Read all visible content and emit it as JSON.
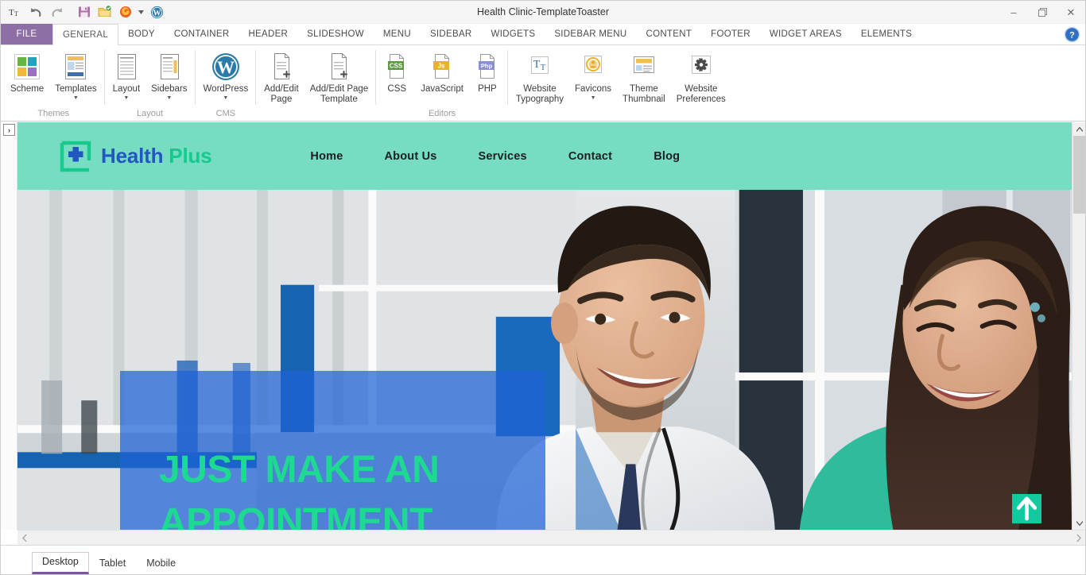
{
  "window": {
    "title": "Health Clinic-TemplateToaster",
    "minimize_label": "–",
    "restore_label": "❐",
    "close_label": "✕"
  },
  "quick_access": [
    {
      "name": "text-tool-icon",
      "tooltip": "Text"
    },
    {
      "name": "undo-icon",
      "tooltip": "Undo"
    },
    {
      "name": "redo-icon",
      "tooltip": "Redo"
    },
    {
      "name": "save-icon",
      "tooltip": "Save"
    },
    {
      "name": "export-icon",
      "tooltip": "Export"
    },
    {
      "name": "firefox-preview-icon",
      "tooltip": "Preview in Firefox"
    },
    {
      "name": "preview-dropdown-caret-icon",
      "tooltip": "More browsers"
    },
    {
      "name": "wordpress-icon",
      "tooltip": "WordPress"
    }
  ],
  "ribbon_tabs": {
    "file": "FILE",
    "items": [
      "GENERAL",
      "BODY",
      "CONTAINER",
      "HEADER",
      "SLIDESHOW",
      "MENU",
      "SIDEBAR",
      "WIDGETS",
      "SIDEBAR MENU",
      "CONTENT",
      "FOOTER",
      "WIDGET AREAS",
      "ELEMENTS"
    ],
    "active": "GENERAL",
    "help_label": "?"
  },
  "ribbon_groups": [
    {
      "label": "Themes",
      "buttons": [
        {
          "label": "Scheme",
          "icon": "color-scheme-icon",
          "caret": false
        },
        {
          "label": "Templates",
          "icon": "templates-icon",
          "caret": true
        }
      ]
    },
    {
      "label": "Layout",
      "buttons": [
        {
          "label": "Layout",
          "icon": "layout-icon",
          "caret": true
        },
        {
          "label": "Sidebars",
          "icon": "sidebars-icon",
          "caret": true
        }
      ]
    },
    {
      "label": "CMS",
      "buttons": [
        {
          "label": "WordPress",
          "icon": "wordpress-icon",
          "caret": true
        }
      ]
    },
    {
      "label": "",
      "buttons": [
        {
          "label": "Add/Edit\nPage",
          "icon": "add-edit-page-icon",
          "caret": false
        },
        {
          "label": "Add/Edit Page\nTemplate",
          "icon": "add-edit-page-template-icon",
          "caret": false
        }
      ]
    },
    {
      "label": "Editors",
      "buttons": [
        {
          "label": "CSS",
          "icon": "css-file-icon",
          "caret": false
        },
        {
          "label": "JavaScript",
          "icon": "js-file-icon",
          "caret": false
        },
        {
          "label": "PHP",
          "icon": "php-file-icon",
          "caret": false
        }
      ]
    },
    {
      "label": "",
      "buttons": [
        {
          "label": "Website\nTypography",
          "icon": "typography-icon",
          "caret": false
        },
        {
          "label": "Favicons",
          "icon": "favicon-icon",
          "caret": true
        },
        {
          "label": "Theme\nThumbnail",
          "icon": "theme-thumbnail-icon",
          "caret": false
        },
        {
          "label": "Website\nPreferences",
          "icon": "website-preferences-gear-icon",
          "caret": false
        }
      ]
    }
  ],
  "preview": {
    "expander_label": "›",
    "site": {
      "logo": {
        "text_primary": "Health",
        "text_secondary": "Plus"
      },
      "nav": [
        "Home",
        "About Us",
        "Services",
        "Contact",
        "Blog"
      ],
      "hero": {
        "headline": "JUST MAKE AN APPOINTMENT"
      },
      "scroll_top_label": "↑"
    }
  },
  "device_tabs": {
    "items": [
      "Desktop",
      "Tablet",
      "Mobile"
    ],
    "active": "Desktop"
  },
  "scrollbars": {
    "vertical_up": "▲",
    "vertical_down": "▼",
    "horizontal_left": "◀",
    "horizontal_right": "▶"
  },
  "colors": {
    "file_tab": "#8e6fa5",
    "site_header_teal": "#76dcc2",
    "hero_overlay_blue": "#1f61d6",
    "hero_text_green": "#1ed992",
    "logo_blue": "#2256c0",
    "logo_green": "#16c98d",
    "active_device_underline": "#7a579a"
  }
}
